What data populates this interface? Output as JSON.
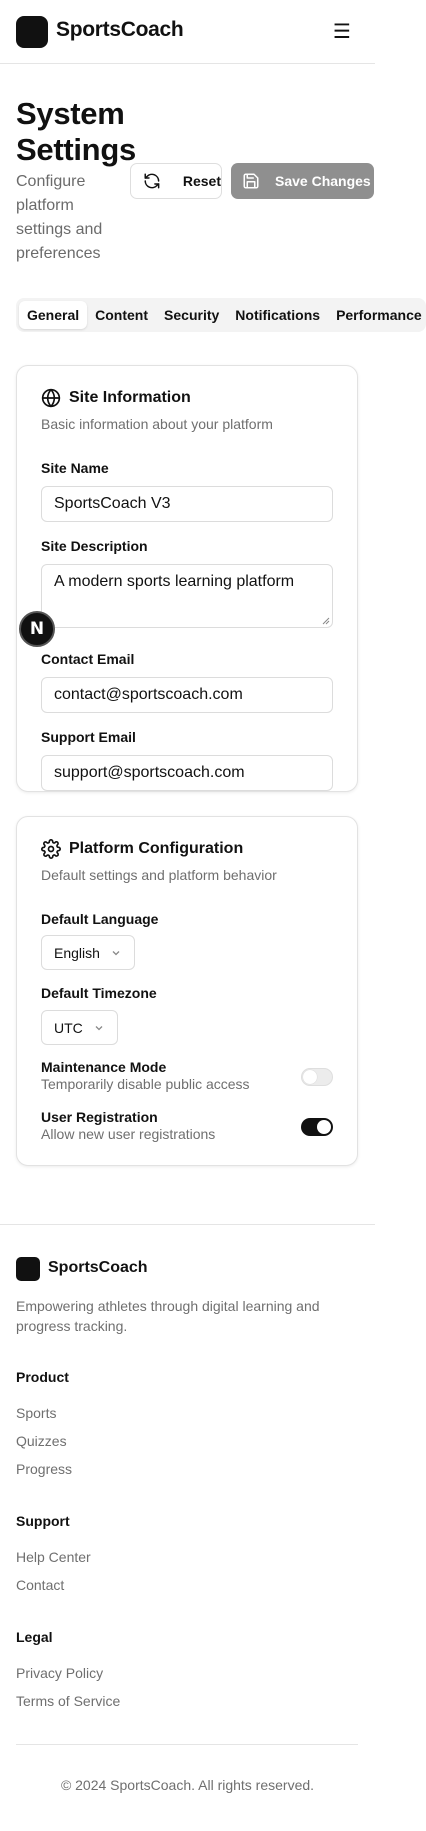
{
  "header": {
    "brand": "SportsCoach",
    "menu_icon": "hamburger-icon",
    "menu_glyph": "☰"
  },
  "page": {
    "title": "System Settings",
    "subtitle": "Configure platform settings and preferences",
    "reset_label": "Reset",
    "save_label": "Save Changes"
  },
  "tabs": [
    {
      "label": "General",
      "active": true
    },
    {
      "label": "Content",
      "active": false
    },
    {
      "label": "Security",
      "active": false
    },
    {
      "label": "Notifications",
      "active": false
    },
    {
      "label": "Performance",
      "active": false
    }
  ],
  "site_info": {
    "title": "Site Information",
    "subtitle": "Basic information about your platform",
    "site_name_label": "Site Name",
    "site_name_value": "SportsCoach V3",
    "site_description_label": "Site Description",
    "site_description_value": "A modern sports learning platform",
    "contact_email_label": "Contact Email",
    "contact_email_value": "contact@sportscoach.com",
    "support_email_label": "Support Email",
    "support_email_value": "support@sportscoach.com"
  },
  "platform_config": {
    "title": "Platform Configuration",
    "subtitle": "Default settings and platform behavior",
    "language_label": "Default Language",
    "language_value": "English",
    "timezone_label": "Default Timezone",
    "timezone_value": "UTC",
    "maintenance_label": "Maintenance Mode",
    "maintenance_desc": "Temporarily disable public access",
    "maintenance_on": false,
    "registration_label": "User Registration",
    "registration_desc": "Allow new user registrations",
    "registration_on": true
  },
  "dev_badge": "N",
  "footer": {
    "brand": "SportsCoach",
    "tagline": "Empowering athletes through digital learning and progress tracking.",
    "product_heading": "Product",
    "product_links": [
      "Sports",
      "Quizzes",
      "Progress"
    ],
    "support_heading": "Support",
    "support_links": [
      "Help Center",
      "Contact"
    ],
    "legal_heading": "Legal",
    "legal_links": [
      "Privacy Policy",
      "Terms of Service"
    ],
    "copyright": "© 2024 SportsCoach. All rights reserved."
  }
}
